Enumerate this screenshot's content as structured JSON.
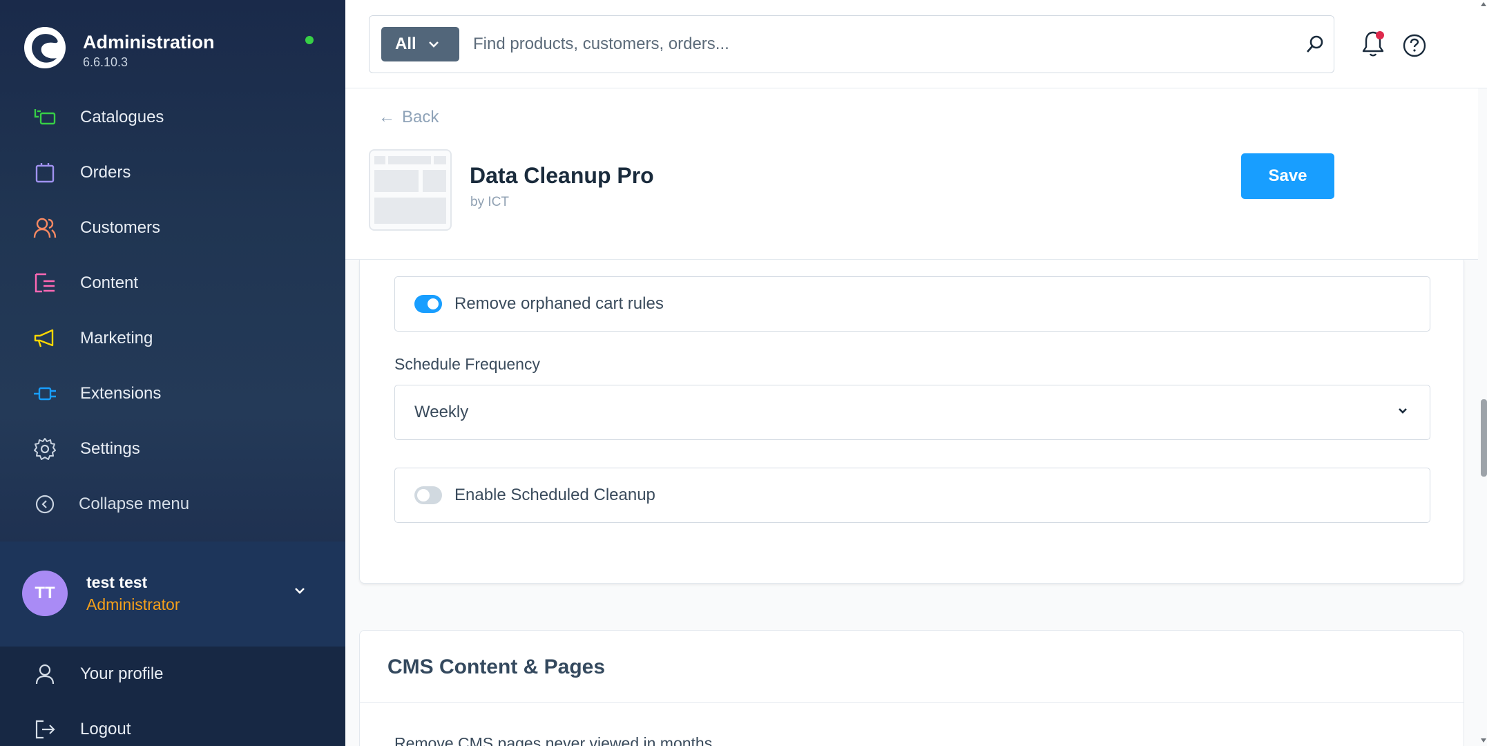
{
  "brand": {
    "title": "Administration",
    "version": "6.6.10.3",
    "status_color": "#37d046"
  },
  "sidebar": {
    "items": [
      {
        "label": "Catalogues",
        "icon": "catalogues-icon",
        "color": "#37d046"
      },
      {
        "label": "Orders",
        "icon": "orders-icon",
        "color": "#a092f0"
      },
      {
        "label": "Customers",
        "icon": "customers-icon",
        "color": "#f88962"
      },
      {
        "label": "Content",
        "icon": "content-icon",
        "color": "#ff68b4"
      },
      {
        "label": "Marketing",
        "icon": "marketing-icon",
        "color": "#ffd700"
      },
      {
        "label": "Extensions",
        "icon": "extensions-icon",
        "color": "#189eff"
      },
      {
        "label": "Settings",
        "icon": "settings-icon",
        "color": "#c9d3e0"
      }
    ],
    "collapse_label": "Collapse menu"
  },
  "user": {
    "initials": "TT",
    "name": "test test",
    "role": "Administrator"
  },
  "bottom_nav": {
    "profile_label": "Your profile",
    "logout_label": "Logout"
  },
  "search": {
    "scope": "All",
    "placeholder": "Find products, customers, orders..."
  },
  "header": {
    "back_label": "Back",
    "app_title": "Data Cleanup Pro",
    "app_author": "by ICT",
    "save_label": "Save"
  },
  "settings": {
    "orphaned_cart_rules": {
      "label": "Remove orphaned cart rules",
      "enabled": true
    },
    "schedule_frequency": {
      "label": "Schedule Frequency",
      "value": "Weekly"
    },
    "scheduled_cleanup": {
      "label": "Enable Scheduled Cleanup",
      "enabled": false
    }
  },
  "cms_section": {
    "title": "CMS Content & Pages",
    "first_field_label": "Remove CMS pages never viewed in months"
  },
  "colors": {
    "accent": "#189eff",
    "sidebar_bg": "#1e3050",
    "role_color": "#f6a01a"
  }
}
